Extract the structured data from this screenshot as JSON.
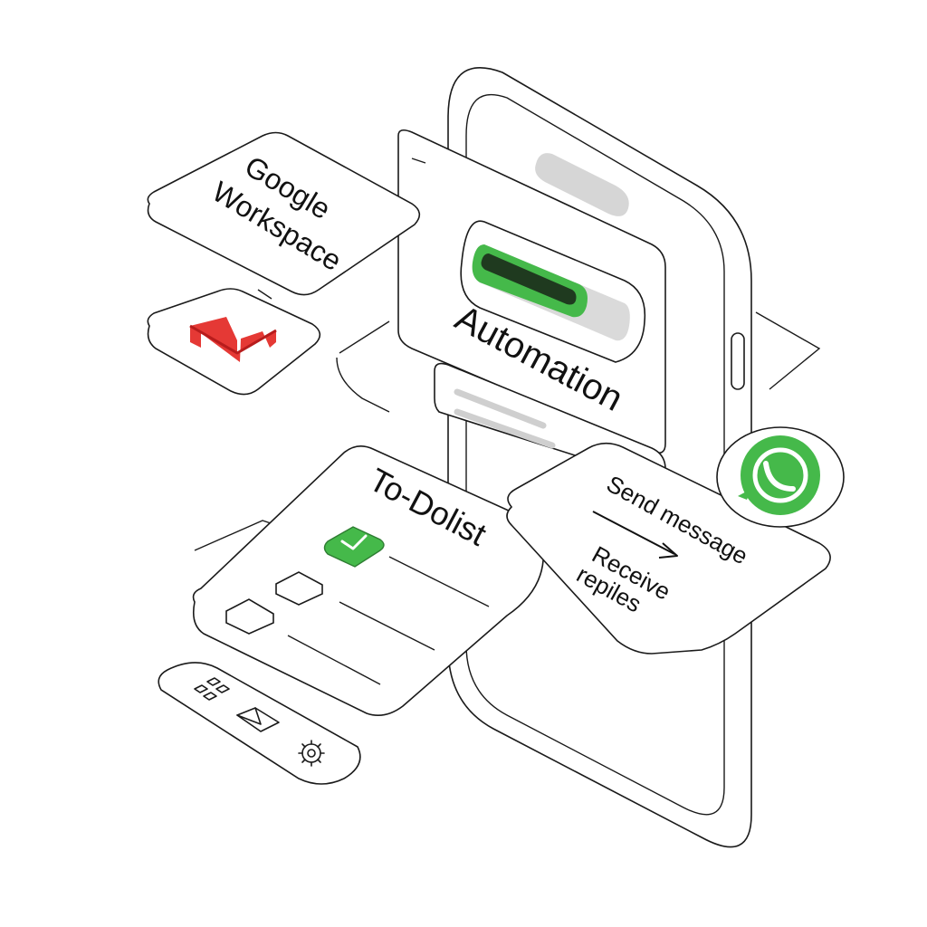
{
  "workspace_card": {
    "line1": "Google",
    "line2": "Workspace"
  },
  "gmail_card": {
    "icon": "gmail-icon"
  },
  "phone": {
    "automation_label": "Automation",
    "progress": 0.72,
    "accent_color": "#45b94a"
  },
  "todo_card": {
    "title": "To-Dolist",
    "checked_items": 1,
    "unchecked_items": 2
  },
  "message_card": {
    "line1": "Send message",
    "line2": "Receive",
    "line3": "repiles"
  },
  "whatsapp": {
    "icon": "whatsapp-icon",
    "color": "#45b94a"
  },
  "toolbar": {
    "icons": [
      "grid-icon",
      "mail-icon",
      "gear-icon"
    ]
  }
}
